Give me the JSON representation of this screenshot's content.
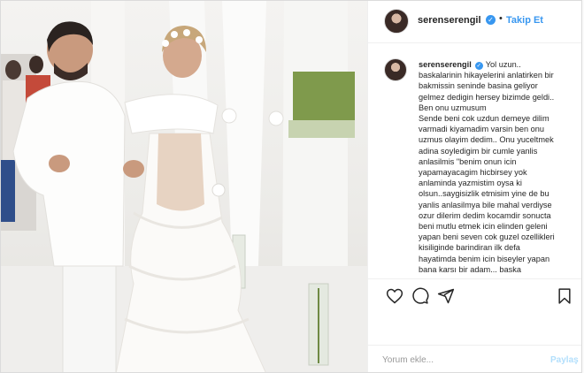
{
  "header": {
    "username": "serenserengil",
    "verified_mark": "✓",
    "separator": "•",
    "follow_label": "Takip Et"
  },
  "caption": {
    "username": "serenserengil",
    "lines": [
      "Yol uzun..",
      "baskalarinin hikayelerini anlatirken bir",
      "bakmissin seninde basina geliyor",
      "gelmez dedigin hersey bizimde geldi..",
      "Ben onu uzmusum",
      "Sende beni cok uzdun demeye dilim",
      "varmadi kiyamadim varsin ben onu",
      "uzmus olayim dedim.. Onu yuceltmek",
      "adina soyledigim bir cumle yanlis",
      "anlasilmis \"benim onun icin",
      "yapamayacagim hicbirsey yok",
      "anlaminda yazmistim oysa ki",
      "olsun..saygisizlik etmisim yine de bu",
      "yanlis anlasilmya bile mahal verdiyse",
      "ozur dilerim dedim kocamdir sonucta",
      "beni mutlu etmek icin elinden geleni",
      "yapan beni seven cok guzel ozellikleri",
      "kisiliginde barindiran ilk defa",
      "hayatimda benim icin biseyler yapan",
      "bana karsı bir adam... baska"
    ]
  },
  "actions": {
    "like_icon": "heart-icon",
    "comment_icon": "comment-icon",
    "share_icon": "share-icon",
    "save_icon": "bookmark-icon"
  },
  "comment": {
    "placeholder": "Yorum ekle...",
    "share_label": "Paylaş"
  },
  "colors": {
    "accent": "#3897f0",
    "share_disabled": "#b2dffc",
    "text": "#262626"
  }
}
